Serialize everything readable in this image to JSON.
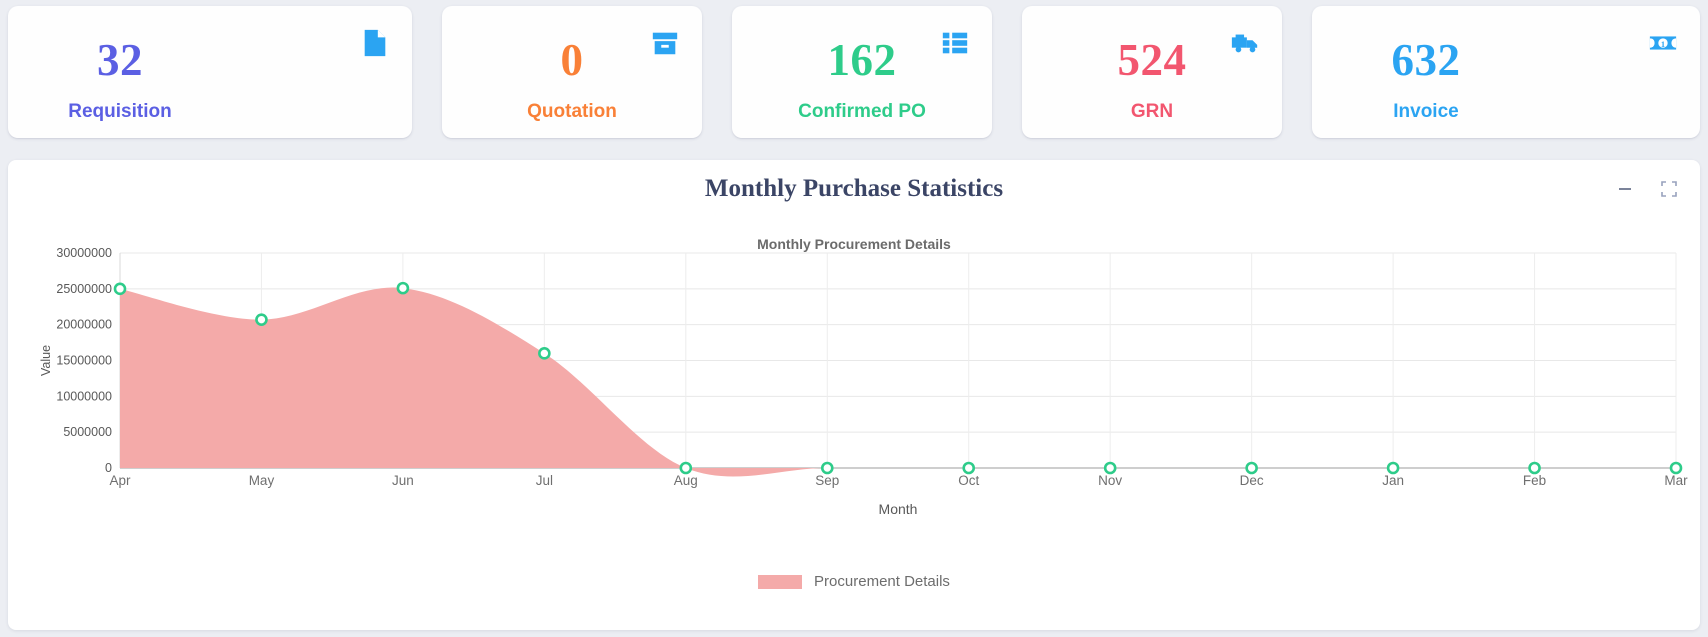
{
  "kpis": [
    {
      "value": "32",
      "label": "Requisition",
      "value_color": "#5b5fe3",
      "label_color": "#5b5fe3",
      "icon": "document-icon",
      "icon_color": "#2ba4f2"
    },
    {
      "value": "0",
      "label": "Quotation",
      "value_color": "#f98037",
      "label_color": "#f98037",
      "icon": "archive-box-icon",
      "icon_color": "#2ba4f2"
    },
    {
      "value": "162",
      "label": "Confirmed PO",
      "value_color": "#2ecc8a",
      "label_color": "#2ecc8a",
      "icon": "list-icon",
      "icon_color": "#2ba4f2"
    },
    {
      "value": "524",
      "label": "GRN",
      "value_color": "#f2566f",
      "label_color": "#f2566f",
      "icon": "truck-icon",
      "icon_color": "#2ba4f2"
    },
    {
      "value": "632",
      "label": "Invoice",
      "value_color": "#2ba4f2",
      "label_color": "#2ba4f2",
      "icon": "banknote-icon",
      "icon_color": "#2ba4f2"
    }
  ],
  "panel": {
    "title": "Monthly Purchase Statistics",
    "minimize_icon": "minimize-icon",
    "expand_icon": "expand-icon"
  },
  "chart_data": {
    "type": "area",
    "title": "Monthly Procurement Details",
    "xlabel": "Month",
    "ylabel": "Value",
    "categories": [
      "Apr",
      "May",
      "Jun",
      "Jul",
      "Aug",
      "Sep",
      "Oct",
      "Nov",
      "Dec",
      "Jan",
      "Feb",
      "Mar"
    ],
    "series": [
      {
        "name": "Procurement Details",
        "values": [
          25000000,
          20700000,
          25100000,
          16000000,
          0,
          0,
          0,
          0,
          0,
          0,
          0,
          0
        ]
      }
    ],
    "legend": [
      "Procurement Details"
    ],
    "legend_position": "bottom",
    "ylim": [
      0,
      30000000
    ],
    "yticks": [
      0,
      5000000,
      10000000,
      15000000,
      20000000,
      25000000,
      30000000
    ],
    "ytick_labels": [
      "0",
      "5000000",
      "10000000",
      "15000000",
      "20000000",
      "25000000",
      "30000000"
    ],
    "grid": true,
    "area_color": "#f4aaa9",
    "marker_color": "#2ecc8a",
    "smooth": true
  }
}
